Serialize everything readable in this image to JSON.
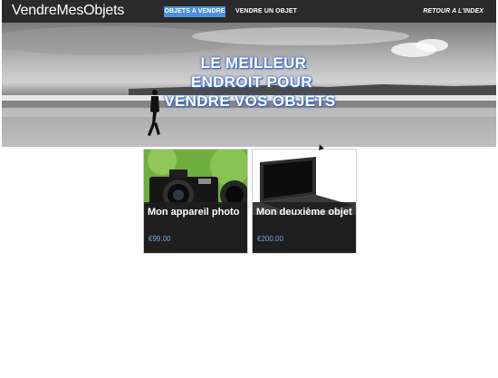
{
  "navbar": {
    "brand": "VendreMesObjets",
    "links": [
      {
        "label": "OBJETS A VENDRE",
        "active": true
      },
      {
        "label": "VENDRE UN OBJET",
        "active": false
      }
    ],
    "back_link": "RETOUR A L'INDEX"
  },
  "hero": {
    "title_lines": [
      "LE MEILLEUR",
      "ENDROIT POUR",
      "VENDRE VOS OBJETS"
    ]
  },
  "products": [
    {
      "name": "Mon appareil photo",
      "price": "€99.00",
      "image": "camera-photo"
    },
    {
      "name": "Mon deuxième objet",
      "price": "€200.00",
      "image": "laptop-photo"
    }
  ],
  "colors": {
    "navbar_bg": "#2a2a2a",
    "accent": "#4a90e2",
    "price": "#6aa6f0",
    "hero_text_glow": "#3c6fd0"
  }
}
